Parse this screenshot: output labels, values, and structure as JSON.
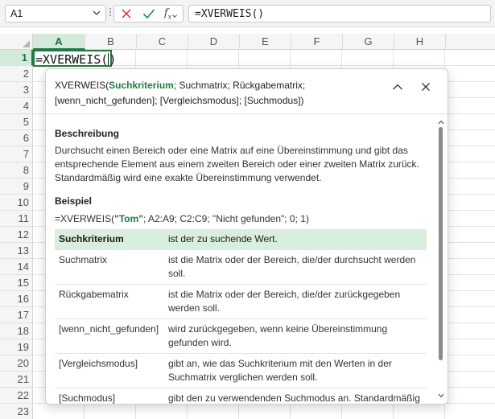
{
  "formula_bar": {
    "name_box": "A1",
    "formula": "=XVERWEIS()"
  },
  "columns": [
    "A",
    "B",
    "C",
    "D",
    "E",
    "F",
    "G",
    "H"
  ],
  "rows": [
    "1",
    "2",
    "3",
    "4",
    "5",
    "6",
    "7",
    "8",
    "9",
    "10",
    "11",
    "12",
    "13",
    "14",
    "15",
    "16",
    "17",
    "18",
    "19",
    "20",
    "21",
    "22",
    "23"
  ],
  "active_cell": {
    "ref": "A1",
    "text_before_caret": "=XVERWEIS(",
    "text_after_caret": ")"
  },
  "tooltip": {
    "signature": {
      "function_name": "XVERWEIS(",
      "current_arg": "Suchkriterium",
      "rest_line1": "; Suchmatrix; Rückgabematrix;",
      "rest_line2": "[wenn_nicht_gefunden]; [Vergleichsmodus]; [Suchmodus])"
    },
    "description_heading": "Beschreibung",
    "description": "Durchsucht einen Bereich oder eine Matrix auf eine Übereinstimmung und gibt das entsprechende Element aus einem zweiten Bereich oder einer zweiten Matrix zurück. Standardmäßig wird eine exakte Übereinstimmung verwendet.",
    "example_heading": "Beispiel",
    "example_prefix": "=XVERWEIS(",
    "example_string": "\"Tom\"",
    "example_suffix": "; A2:A9; C2:C9; \"Nicht gefunden\"; 0; 1)",
    "params": [
      {
        "name": "Suchkriterium",
        "desc": "ist der zu suchende Wert."
      },
      {
        "name": "Suchmatrix",
        "desc": "ist die Matrix oder der Bereich, die/der durchsucht werden soll."
      },
      {
        "name": "Rückgabematrix",
        "desc": "ist die Matrix oder der Bereich, die/der zurückgegeben werden soll."
      },
      {
        "name": "[wenn_nicht_gefunden]",
        "desc": "wird zurückgegeben, wenn keine Übereinstimmung gefunden wird."
      },
      {
        "name": "[Vergleichsmodus]",
        "desc": "gibt an, wie das Suchkriterium mit den Werten in der Suchmatrix verglichen werden soll."
      },
      {
        "name": "[Suchmodus]",
        "desc": "gibt den zu verwendenden Suchmodus an. Standardmäßig wird eine Suche vom ersten zum letzten Element"
      }
    ]
  },
  "colors": {
    "accent": "#1f7a45",
    "highlight": "#d9eedf",
    "cancel_red": "#d13438",
    "confirm_green": "#1f8a4c"
  },
  "icons": {
    "name_box_dropdown": "chevron-down-icon",
    "cancel": "x-icon",
    "enter": "check-icon",
    "insert_function": "fx-icon",
    "collapse": "chevron-up-icon",
    "close": "close-icon"
  }
}
